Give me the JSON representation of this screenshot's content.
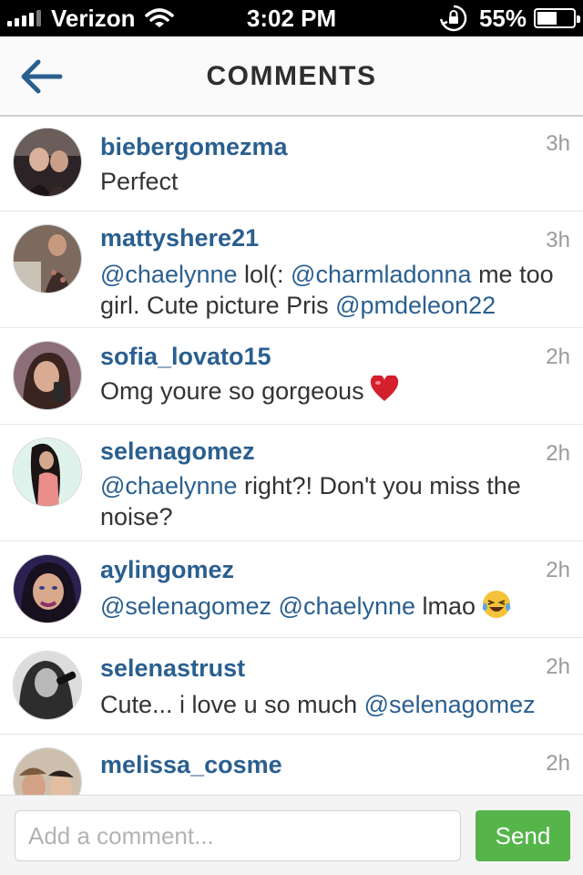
{
  "status_bar": {
    "carrier": "Verizon",
    "time": "3:02 PM",
    "battery": "55%",
    "battery_level": 0.55
  },
  "header": {
    "title": "COMMENTS",
    "back_icon": "arrow-left-icon"
  },
  "comments": [
    {
      "username": "biebergomezma",
      "time": "3h",
      "segments": [
        {
          "text": "Perfect",
          "mention": false
        }
      ]
    },
    {
      "username": "mattyshere21",
      "time": "3h",
      "segments": [
        {
          "text": "@chaelynne",
          "mention": true
        },
        {
          "text": " lol(: ",
          "mention": false
        },
        {
          "text": "@charmladonna",
          "mention": true
        },
        {
          "text": " me too girl. Cute picture Pris ",
          "mention": false
        },
        {
          "text": "@pmdeleon22",
          "mention": true
        }
      ]
    },
    {
      "username": "sofia_lovato15",
      "time": "2h",
      "segments": [
        {
          "text": "Omg youre so gorgeous",
          "mention": false
        }
      ],
      "emoji": "heart-emoji"
    },
    {
      "username": "selenagomez",
      "time": "2h",
      "segments": [
        {
          "text": "@chaelynne",
          "mention": true
        },
        {
          "text": " right?! Don't you miss the noise?",
          "mention": false
        }
      ]
    },
    {
      "username": "aylingomez",
      "time": "2h",
      "segments": [
        {
          "text": "@selenagomez",
          "mention": true
        },
        {
          "text": " ",
          "mention": false
        },
        {
          "text": "@chaelynne",
          "mention": true
        },
        {
          "text": " lmao",
          "mention": false
        }
      ],
      "emoji": "laughing-tears-emoji"
    },
    {
      "username": "selenastrust",
      "time": "2h",
      "segments": [
        {
          "text": "Cute... i love u so much ",
          "mention": false
        },
        {
          "text": "@selenagomez",
          "mention": true
        }
      ]
    },
    {
      "username": "melissa_cosme",
      "time": "2h",
      "segments": []
    }
  ],
  "input_bar": {
    "placeholder": "Add a comment...",
    "send_label": "Send"
  },
  "colors": {
    "username": "#2a5f8f",
    "send_button": "#55b44a",
    "back_arrow": "#2a5f8f"
  }
}
